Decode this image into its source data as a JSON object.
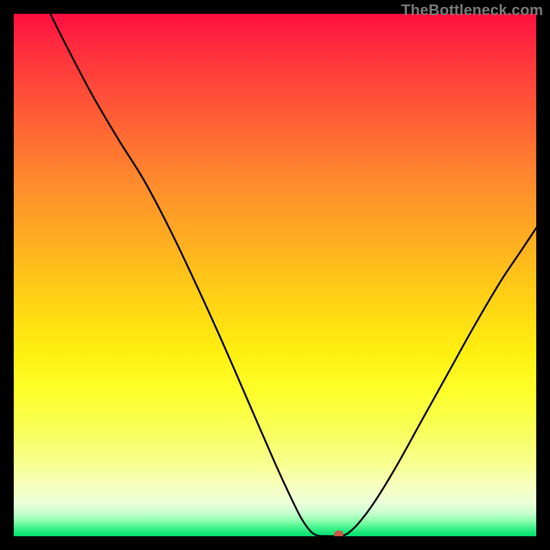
{
  "watermark": "TheBottleneck.com",
  "chart_data": {
    "type": "line",
    "title": "",
    "xlabel": "",
    "ylabel": "",
    "xlim": [
      0,
      100
    ],
    "ylim": [
      0,
      100
    ],
    "grid": false,
    "legend": false,
    "background": {
      "type": "vertical-gradient",
      "description": "red (top) through orange, yellow, to green (bottom)",
      "stops": [
        {
          "pos": 0,
          "color": "#ff0e3f"
        },
        {
          "pos": 18,
          "color": "#ff5736"
        },
        {
          "pos": 44,
          "color": "#ffb020"
        },
        {
          "pos": 65,
          "color": "#fff010"
        },
        {
          "pos": 86,
          "color": "#f7ff8e"
        },
        {
          "pos": 97,
          "color": "#8effb0"
        },
        {
          "pos": 100,
          "color": "#07e06f"
        }
      ]
    },
    "series": [
      {
        "name": "left-branch",
        "description": "descending curve from top-left toward minimum",
        "x": [
          7,
          10,
          15,
          20,
          25,
          30,
          35,
          40,
          45,
          50,
          53,
          55,
          56.5,
          57.5,
          58.5
        ],
        "y": [
          100,
          94,
          84.5,
          76,
          68,
          58.5,
          48,
          37,
          25.5,
          14,
          7.5,
          3.5,
          1.3,
          0.4,
          0.05
        ]
      },
      {
        "name": "flat-minimum",
        "description": "short flat segment at the bottom",
        "x": [
          58.5,
          60,
          61.5,
          62.8
        ],
        "y": [
          0.05,
          0.02,
          0.02,
          0.05
        ]
      },
      {
        "name": "right-branch",
        "description": "ascending curve from minimum toward upper-right",
        "x": [
          62.8,
          64,
          66,
          69,
          73,
          78,
          83,
          88,
          93,
          97,
          100
        ],
        "y": [
          0.05,
          0.6,
          2.5,
          6.5,
          13,
          22,
          31,
          40,
          48.5,
          54.5,
          59
        ]
      }
    ],
    "marker": {
      "name": "highlight-point",
      "x": 62.2,
      "y": 0.25,
      "color": "#cc5544",
      "shape": "rounded-rect"
    }
  }
}
